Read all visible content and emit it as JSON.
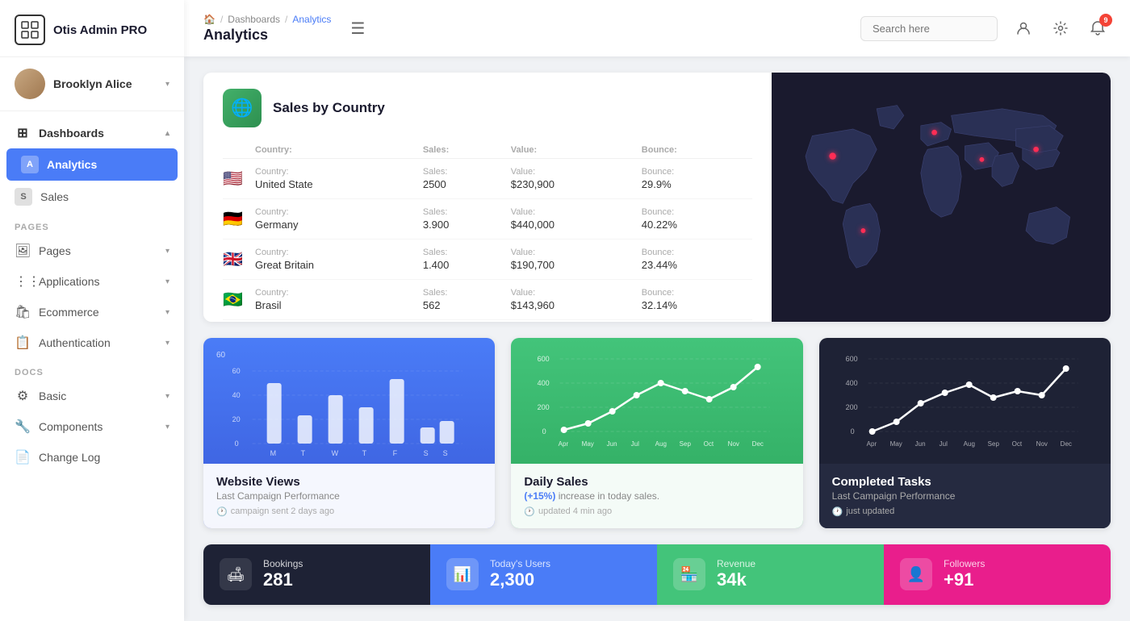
{
  "app": {
    "name": "Otis Admin PRO"
  },
  "user": {
    "name": "Brooklyn Alice"
  },
  "sidebar": {
    "dashboards_label": "Dashboards",
    "analytics_label": "Analytics",
    "analytics_badge": "A",
    "sales_label": "Sales",
    "sales_badge": "S",
    "pages_section": "PAGES",
    "pages_label": "Pages",
    "applications_label": "Applications",
    "ecommerce_label": "Ecommerce",
    "authentication_label": "Authentication",
    "docs_section": "DOCS",
    "basic_label": "Basic",
    "components_label": "Components",
    "changelog_label": "Change Log"
  },
  "header": {
    "breadcrumb_home": "🏠",
    "breadcrumb_dashboards": "Dashboards",
    "breadcrumb_analytics": "Analytics",
    "page_title": "Analytics",
    "search_placeholder": "Search here",
    "notif_count": "9"
  },
  "sales_card": {
    "title": "Sales by Country",
    "columns": {
      "country": "Country:",
      "sales": "Sales:",
      "value": "Value:",
      "bounce": "Bounce:"
    },
    "rows": [
      {
        "flag": "🇺🇸",
        "country": "United State",
        "sales": "2500",
        "value": "$230,900",
        "bounce": "29.9%"
      },
      {
        "flag": "🇩🇪",
        "country": "Germany",
        "sales": "3.900",
        "value": "$440,000",
        "bounce": "40.22%"
      },
      {
        "flag": "🇬🇧",
        "country": "Great Britain",
        "sales": "1.400",
        "value": "$190,700",
        "bounce": "23.44%"
      },
      {
        "flag": "🇧🇷",
        "country": "Brasil",
        "sales": "562",
        "value": "$143,960",
        "bounce": "32.14%"
      }
    ]
  },
  "website_views": {
    "title": "Website Views",
    "subtitle": "Last Campaign Performance",
    "meta": "campaign sent 2 days ago",
    "y_labels": [
      "60",
      "40",
      "20",
      "0"
    ],
    "x_labels": [
      "M",
      "T",
      "W",
      "T",
      "F",
      "S",
      "S"
    ]
  },
  "daily_sales": {
    "title": "Daily Sales",
    "subtitle": "(+15%) increase in today sales.",
    "meta": "updated 4 min ago",
    "y_labels": [
      "600",
      "400",
      "200",
      "0"
    ],
    "x_labels": [
      "Apr",
      "May",
      "Jun",
      "Jul",
      "Aug",
      "Sep",
      "Oct",
      "Nov",
      "Dec"
    ]
  },
  "completed_tasks": {
    "title": "Completed Tasks",
    "subtitle": "Last Campaign Performance",
    "meta": "just updated",
    "y_labels": [
      "600",
      "400",
      "200",
      "0"
    ],
    "x_labels": [
      "Apr",
      "May",
      "Jun",
      "Jul",
      "Aug",
      "Sep",
      "Oct",
      "Nov",
      "Dec"
    ]
  },
  "stats": [
    {
      "icon": "🛋",
      "label": "Bookings",
      "value": "281",
      "type": "dark"
    },
    {
      "icon": "📊",
      "label": "Today's Users",
      "value": "2,300",
      "type": "blue"
    },
    {
      "icon": "🏪",
      "label": "Revenue",
      "value": "34k",
      "type": "green"
    },
    {
      "icon": "👤",
      "label": "Followers",
      "value": "+91",
      "type": "pink"
    }
  ]
}
